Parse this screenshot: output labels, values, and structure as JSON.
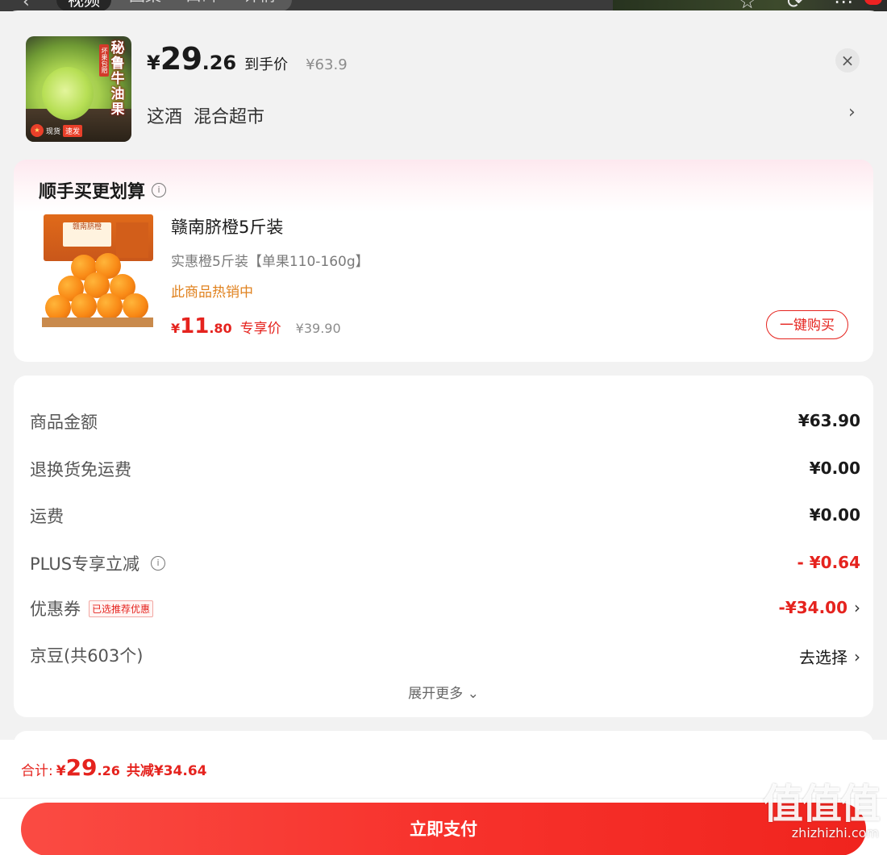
{
  "background_tabs": [
    "视频",
    "图集",
    "口碑",
    "详情"
  ],
  "product": {
    "thumb_title_chars": [
      "秘",
      "鲁",
      "牛",
      "油",
      "果"
    ],
    "thumb_tag": "坏果包赔",
    "thumb_badge": "现货",
    "thumb_fast": "速发",
    "yen": "¥",
    "price_int": "29",
    "price_dec": ".26",
    "price_tag": "到手价",
    "orig_price": "¥63.9",
    "variant": "这酒  混合超市",
    "variant_chevron": "›",
    "close": "×"
  },
  "upsell": {
    "title": "顺手买更划算",
    "info": "i",
    "box_label": "赣南脐橙",
    "name": "赣南脐橙5斤装",
    "spec": "实惠橙5斤装【单果110-160g】",
    "hot": "此商品热销中",
    "yen": "¥",
    "price_int": "11",
    "price_dec": ".80",
    "price_tag": "专享价",
    "orig_price": "¥39.90",
    "buy_button": "一键购买"
  },
  "breakdown": {
    "rows": [
      {
        "label": "商品金额",
        "value": "¥63.90"
      },
      {
        "label": "退换货免运费",
        "value": "¥0.00"
      },
      {
        "label": "运费",
        "value": "¥0.00"
      },
      {
        "label": "PLUS专享立减",
        "value": "- ¥0.64"
      },
      {
        "label": "优惠券",
        "badge": "已选推荐优惠",
        "value": "-¥34.00"
      },
      {
        "label": "京豆(共603个)",
        "value": "去选择"
      }
    ],
    "expand": "展开更多",
    "expand_icon": "⌄",
    "chevron": "›",
    "info": "i"
  },
  "footer": {
    "total_label": "合计:",
    "yen": "¥",
    "total_int": "29",
    "total_dec": ".26",
    "savings": "共减¥34.64",
    "pay_button": "立即支付"
  },
  "watermark": {
    "logo": "值值值",
    "url": "zhizhizhi.com"
  },
  "colors": {
    "accent_red": "#e5231e",
    "hot_orange": "#e0821f"
  }
}
